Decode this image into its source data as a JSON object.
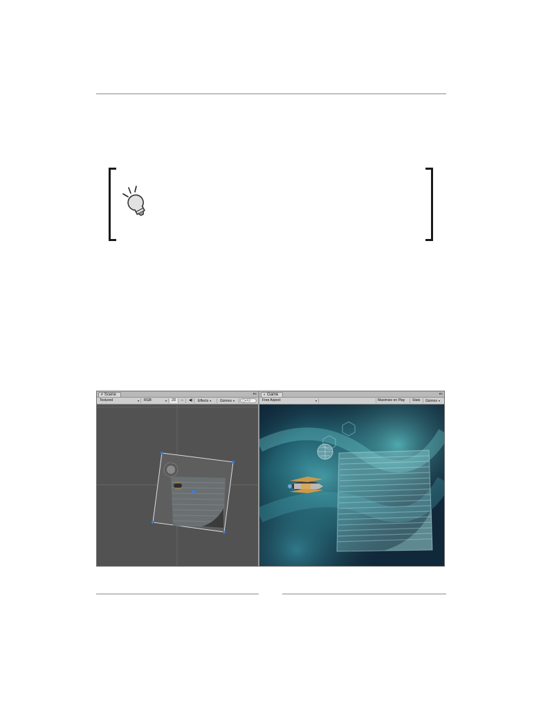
{
  "scene_panel": {
    "tab_label": "Scene",
    "tab_icon": "scene-icon",
    "toolbar": {
      "shading_mode": "Textured",
      "render_mode": "RGB",
      "mode_2d": "2D",
      "effects": "Effects",
      "gizmos": "Gizmos",
      "search_placeholder": "Q▾All"
    }
  },
  "game_panel": {
    "tab_label": "Game",
    "tab_icon": "game-icon",
    "toolbar": {
      "aspect": "Free Aspect",
      "maximize_on_play": "Maximize on Play",
      "stats": "Stats",
      "gizmos": "Gizmos"
    }
  },
  "icons": {
    "tip": "lightbulb-icon",
    "lighting": "sun-icon",
    "audio": "speaker-icon",
    "dropdown": "chevron-down-icon"
  },
  "colors": {
    "scene_bg": "#515151",
    "selection": "#dcdcdc",
    "handle": "#3a7de0",
    "nebula": "#3aa6b0"
  }
}
